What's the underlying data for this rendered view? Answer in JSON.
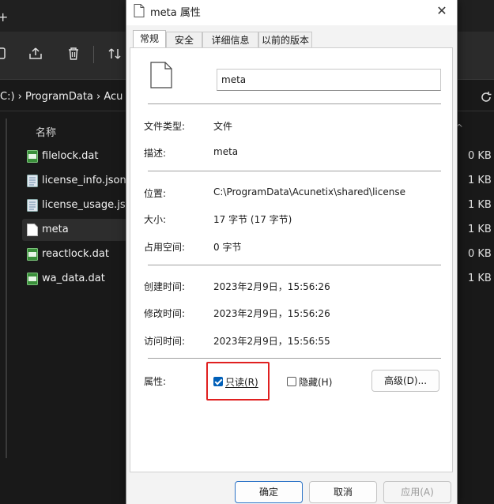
{
  "explorer": {
    "breadcrumb": "C:)  ›  ProgramData  ›  Acu",
    "column_name": "名称",
    "files": [
      {
        "name": "filelock.dat",
        "size": "0 KB",
        "icon": "dat-file-icon"
      },
      {
        "name": "license_info.json",
        "size": "1 KB",
        "icon": "json-file-icon"
      },
      {
        "name": "license_usage.json",
        "size": "1 KB",
        "icon": "json-file-icon"
      },
      {
        "name": "meta",
        "size": "1 KB",
        "icon": "blank-file-icon"
      },
      {
        "name": "reactlock.dat",
        "size": "0 KB",
        "icon": "dat-file-icon"
      },
      {
        "name": "wa_data.dat",
        "size": "1 KB",
        "icon": "dat-file-icon"
      }
    ]
  },
  "dialog": {
    "title": "meta 属性",
    "tabs": [
      "常规",
      "安全",
      "详细信息",
      "以前的版本"
    ],
    "file_name": "meta",
    "labels": {
      "type": "文件类型:",
      "description": "描述:",
      "location": "位置:",
      "size": "大小:",
      "disk_size": "占用空间:",
      "created": "创建时间:",
      "modified": "修改时间:",
      "accessed": "访问时间:",
      "attributes": "属性:"
    },
    "values": {
      "type": "文件",
      "description": "meta",
      "location": "C:\\ProgramData\\Acunetix\\shared\\license",
      "size": "17 字节 (17 字节)",
      "disk_size": "0 字节",
      "created": "2023年2月9日，15:56:26",
      "modified": "2023年2月9日，15:56:26",
      "accessed": "2023年2月9日，15:56:55"
    },
    "attributes": {
      "readonly": "只读(R)",
      "readonly_checked": true,
      "hidden": "隐藏(H)",
      "hidden_checked": false,
      "advanced": "高级(D)..."
    },
    "buttons": {
      "ok": "确定",
      "cancel": "取消",
      "apply": "应用(A)"
    }
  },
  "colors": {
    "accent": "#005fb8",
    "highlight": "#e02020",
    "explorer_bg": "#191919"
  }
}
